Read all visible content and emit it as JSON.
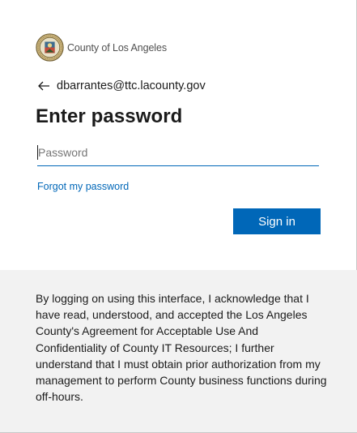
{
  "branding": {
    "org_name": "County of Los Angeles",
    "seal_icon": "county-seal-icon"
  },
  "identity": {
    "back_icon": "back-arrow-icon",
    "email": "dbarrantes@ttc.lacounty.gov"
  },
  "form": {
    "title": "Enter password",
    "password_placeholder": "Password",
    "password_value": "",
    "forgot_link": "Forgot my password",
    "signin_label": "Sign in"
  },
  "footer": {
    "disclaimer": "By logging on using this interface, I acknowledge that I have read, understood, and accepted the Los Angeles County's Agreement for Acceptable Use And Confidentiality of County IT Resources; I further understand that I must obtain prior authorization from my management to perform County business functions during off-hours."
  },
  "colors": {
    "accent": "#0067b8",
    "footer_bg": "#f2f2f2",
    "text": "#1b1b1b"
  }
}
